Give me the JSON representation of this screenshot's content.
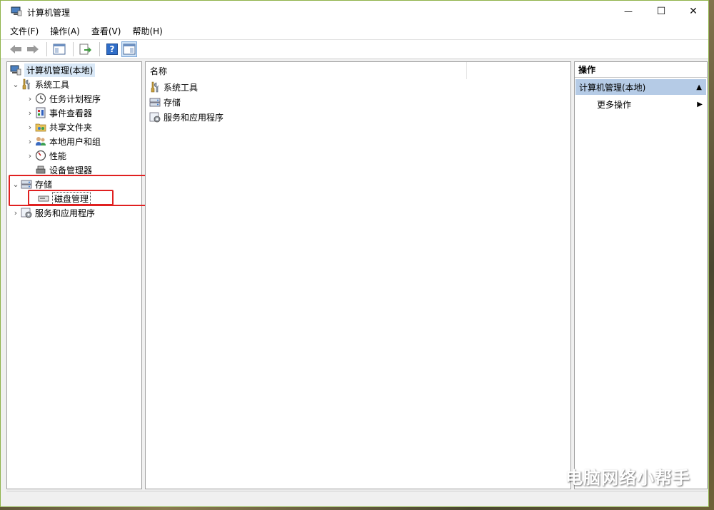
{
  "window": {
    "title": "计算机管理"
  },
  "window_buttons": {
    "minimize": "—",
    "maximize": "☐",
    "close": "✕"
  },
  "menu": [
    {
      "label": "文件(F)"
    },
    {
      "label": "操作(A)"
    },
    {
      "label": "查看(V)"
    },
    {
      "label": "帮助(H)"
    }
  ],
  "toolbar": {
    "icons": [
      "back-arrow-icon",
      "forward-arrow-icon",
      "show-hide-console-tree-icon",
      "export-list-icon",
      "help-icon",
      "show-hide-action-pane-icon"
    ],
    "help_glyph": "?"
  },
  "tree": {
    "root": {
      "label": "计算机管理(本地)"
    },
    "items": [
      {
        "label": "系统工具",
        "expanded": true,
        "icon": "tools-icon"
      },
      {
        "label": "任务计划程序",
        "icon": "clock-icon"
      },
      {
        "label": "事件查看器",
        "icon": "event-viewer-icon"
      },
      {
        "label": "共享文件夹",
        "icon": "shared-folder-icon"
      },
      {
        "label": "本地用户和组",
        "icon": "users-icon"
      },
      {
        "label": "性能",
        "icon": "performance-icon"
      },
      {
        "label": "设备管理器",
        "icon": "device-manager-icon"
      },
      {
        "label": "存储",
        "expanded": true,
        "icon": "storage-icon"
      },
      {
        "label": "磁盘管理",
        "icon": "disk-icon"
      },
      {
        "label": "服务和应用程序",
        "icon": "services-icon"
      }
    ]
  },
  "list": {
    "column_header": "名称",
    "rows": [
      {
        "label": "系统工具"
      },
      {
        "label": "存储"
      },
      {
        "label": "服务和应用程序"
      }
    ]
  },
  "actions": {
    "title": "操作",
    "section": "计算机管理(本地)",
    "items": [
      {
        "label": "更多操作"
      }
    ]
  },
  "watermark": {
    "text": "电脑网络小帮手"
  },
  "colors": {
    "highlight_box": "#e02020",
    "action_section_bg": "#b5cbe6",
    "selection_bg": "#d9e8f7"
  }
}
